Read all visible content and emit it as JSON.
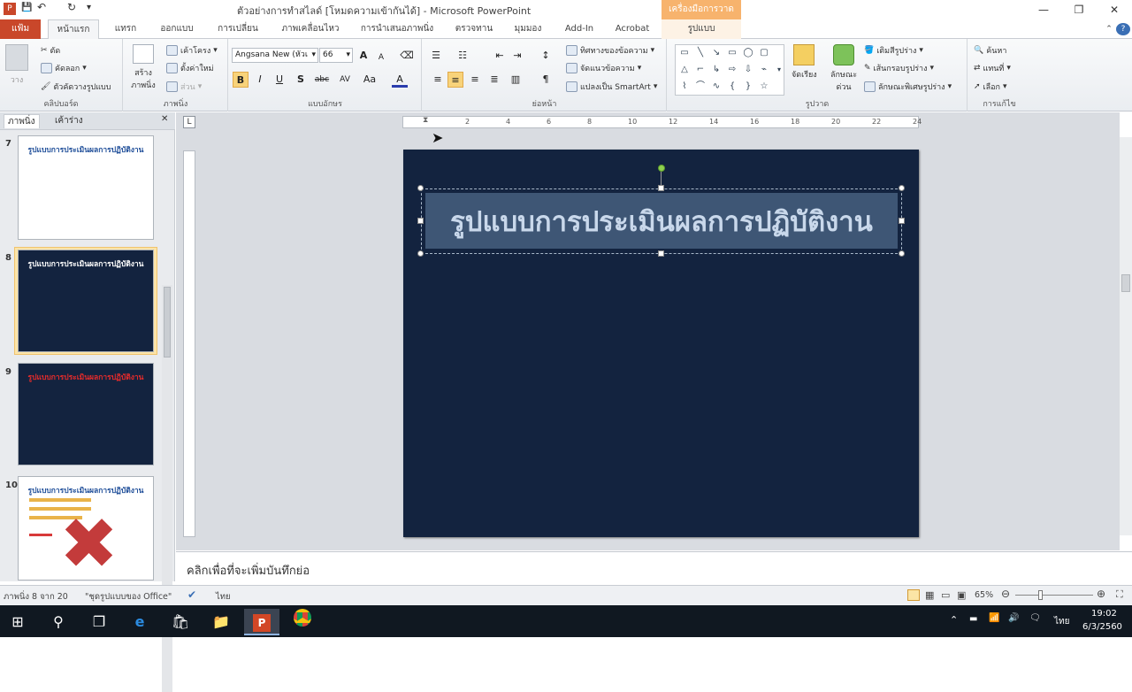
{
  "window": {
    "title": "ตัวอย่างการทำสไลด์ [โหมดความเข้ากันได้]  -  Microsoft PowerPoint",
    "contextual_group": "เครื่องมือการวาด",
    "controls": {
      "minimize": "—",
      "restore": "❐",
      "close": "✕"
    }
  },
  "quick_access": {
    "app": "P",
    "save": "💾",
    "undo": "↶",
    "redo": "↻",
    "customize": "▾"
  },
  "tabs": {
    "file": "แฟ้ม",
    "home": "หน้าแรก",
    "insert": "แทรก",
    "design": "ออกแบบ",
    "transitions": "การเปลี่ยน",
    "animations": "ภาพเคลื่อนไหว",
    "slideshow": "การนำเสนอภาพนิ่ง",
    "review": "ตรวจทาน",
    "view": "มุมมอง",
    "addin": "Add-In",
    "acrobat": "Acrobat",
    "format": "รูปแบบ"
  },
  "ribbon": {
    "clipboard": {
      "label": "คลิปบอร์ด",
      "paste": "วาง",
      "cut": "ตัด",
      "copy": "คัดลอก",
      "format_painter": "ตัวคัดวางรูปแบบ"
    },
    "slides": {
      "label": "ภาพนิ่ง",
      "new_slide": "สร้าง ภาพนิ่ง",
      "layout": "เค้าโครง",
      "reset": "ตั้งค่าใหม่",
      "section": "ส่วน"
    },
    "font": {
      "label": "แบบอักษร",
      "font_name": "Angsana New (หัวเ",
      "font_size": "66",
      "bold": "B",
      "italic": "I",
      "underline": "U",
      "shadow": "S",
      "strike": "abc",
      "spacing": "AV",
      "case": "Aa",
      "color": "A",
      "grow": "A",
      "shrink": "A"
    },
    "paragraph": {
      "label": "ย่อหน้า",
      "text_direction": "ทิศทางของข้อความ",
      "align_text": "จัดแนวข้อความ",
      "smartart": "แปลงเป็น SmartArt"
    },
    "drawing": {
      "label": "รูปวาด",
      "arrange": "จัดเรียง",
      "quick_styles": "ลักษณะด่วน",
      "shape_fill": "เติมสีรูปร่าง",
      "shape_outline": "เส้นกรอบรูปร่าง",
      "shape_effects": "ลักษณะพิเศษรูปร่าง"
    },
    "editing": {
      "label": "การแก้ไข",
      "find": "ค้นหา",
      "replace": "แทนที่",
      "select": "เลือก"
    }
  },
  "left_panel": {
    "tab_slides": "ภาพนิ่ง",
    "tab_outline": "เค้าร่าง",
    "close": "✕",
    "thumbnails": [
      {
        "num": "7",
        "title": "รูปแบบการประเมินผลการปฏิบัติงาน",
        "bg": "#ffffff",
        "fg": "#1f4e99",
        "selected": false
      },
      {
        "num": "8",
        "title": "รูปแบบการประเมินผลการปฏิบัติงาน",
        "bg": "#13233f",
        "fg": "#ffffff",
        "selected": true
      },
      {
        "num": "9",
        "title": "รูปแบบการประเมินผลการปฏิบัติงาน",
        "bg": "#13233f",
        "fg": "#e52b2b",
        "selected": false
      },
      {
        "num": "10",
        "title": "รูปแบบการประเมินผลการปฏิบัติงาน",
        "bg": "#ffffff",
        "fg": "#1f4e99",
        "selected": false
      }
    ]
  },
  "slide": {
    "title": "รูปแบบการประเมินผลการปฏิบัติงาน",
    "bg": "#13233f"
  },
  "ruler": {
    "marks": [
      "2",
      "4",
      "6",
      "8",
      "10",
      "12",
      "14",
      "16",
      "18",
      "20",
      "22",
      "24"
    ],
    "toggle": "L"
  },
  "notes": {
    "placeholder": "คลิกเพื่อที่จะเพิ่มบันทึกย่อ"
  },
  "status": {
    "slide_info": "ภาพนิ่ง 8 จาก 20",
    "theme": "\"ชุดรูปแบบของ Office\"",
    "language": "ไทย",
    "zoom": "65%"
  },
  "taskbar": {
    "time": "19:02",
    "date": "6/3/2560",
    "lang": "ไทย"
  }
}
